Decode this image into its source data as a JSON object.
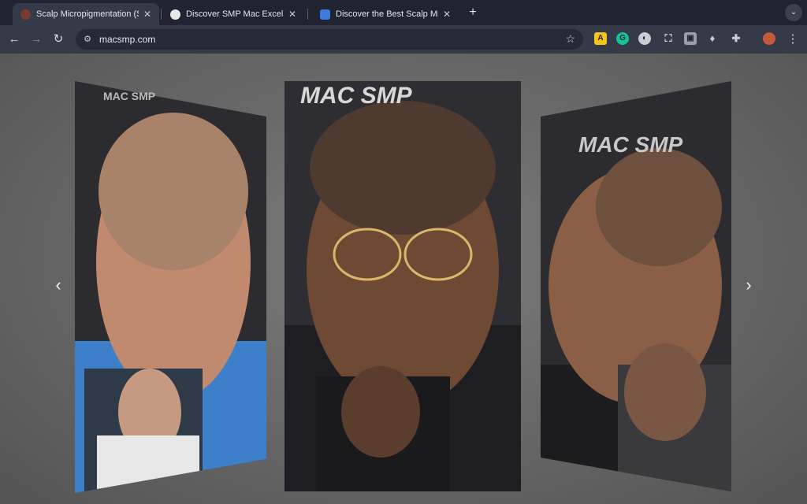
{
  "browser": {
    "tabs": [
      {
        "title": "Scalp Micropigmentation (SMP)",
        "favicon": "site-favicon",
        "active": true
      },
      {
        "title": "Discover SMP Mac Excellence",
        "favicon": "chatgpt-icon",
        "active": false
      },
      {
        "title": "Discover the Best Scalp Micro",
        "favicon": "docs-icon",
        "active": false
      }
    ],
    "new_tab": "+",
    "url": "macsmp.com"
  },
  "carousel": {
    "prev_label": "‹",
    "next_label": "›",
    "slides": [
      {
        "name": "before-after-slide-1",
        "watermark": "MAC SMP"
      },
      {
        "name": "before-after-slide-2",
        "watermark": "MAC SMP"
      },
      {
        "name": "before-after-slide-3",
        "watermark": "MAC SMP"
      }
    ]
  },
  "colors": {
    "chrome_dark": "#1f2430",
    "chrome_toolbar": "#343a48",
    "page_bg": "#6a6a6a",
    "brand_red": "#c1282d"
  }
}
